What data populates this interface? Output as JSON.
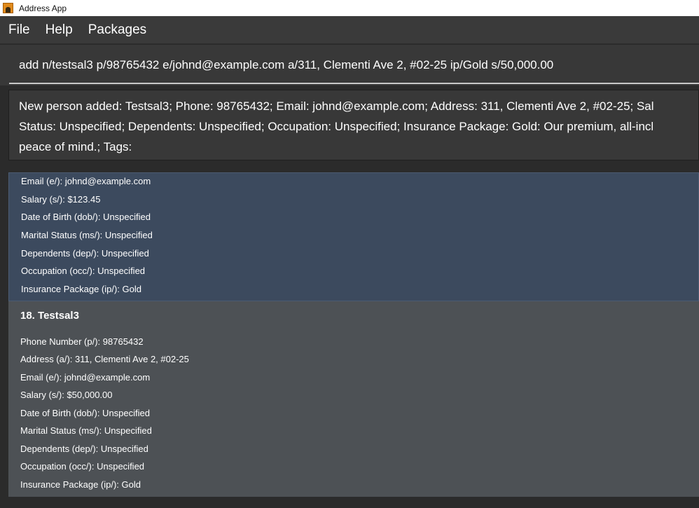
{
  "window": {
    "title": "Address App",
    "icon": "address-book-icon"
  },
  "menu": {
    "items": [
      "File",
      "Help",
      "Packages"
    ]
  },
  "command": {
    "value": "add n/testsal3 p/98765432 e/johnd@example.com a/311, Clementi Ave 2, #02-25 ip/Gold s/50,000.00"
  },
  "result": {
    "lines": [
      "New person added: Testsal3; Phone: 98765432; Email: johnd@example.com; Address: 311, Clementi Ave 2, #02-25; Sal",
      "Status: Unspecified; Dependents: Unspecified; Occupation: Unspecified; Insurance Package: Gold: Our premium, all-incl",
      "peace of mind.; Tags:"
    ]
  },
  "cards": [
    {
      "selected": true,
      "fields": [
        "Email (e/): johnd@example.com",
        "Salary (s/): $123.45",
        "Date of Birth (dob/): Unspecified",
        "Marital Status (ms/): Unspecified",
        "Dependents (dep/): Unspecified",
        "Occupation (occ/): Unspecified",
        "Insurance Package (ip/): Gold"
      ]
    },
    {
      "selected": false,
      "name": "18. Testsal3",
      "fields": [
        "Phone Number (p/): 98765432",
        "Address (a/): 311, Clementi Ave 2, #02-25",
        "Email (e/): johnd@example.com",
        "Salary (s/): $50,000.00",
        "Date of Birth (dob/): Unspecified",
        "Marital Status (ms/): Unspecified",
        "Dependents (dep/): Unspecified",
        "Occupation (occ/): Unspecified",
        "Insurance Package (ip/): Gold"
      ]
    }
  ],
  "colors": {
    "background": "#2b2b2b",
    "selected_card": "#3c4a5e",
    "card": "#4d5155",
    "text": "#ffffff"
  }
}
